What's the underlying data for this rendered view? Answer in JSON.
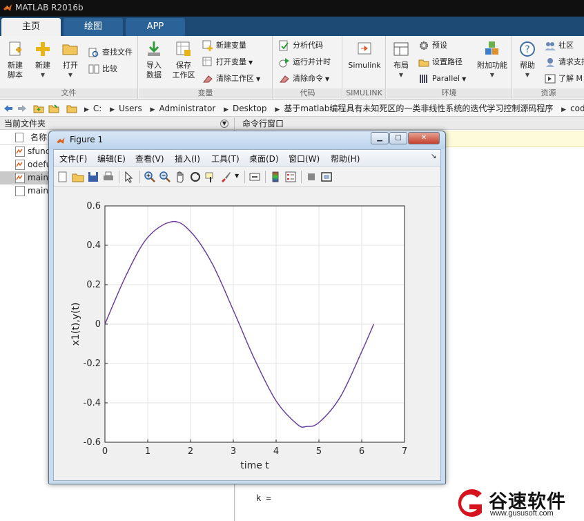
{
  "app": {
    "title": "MATLAB R2016b"
  },
  "tabs": [
    {
      "label": "主页",
      "active": true
    },
    {
      "label": "绘图",
      "active": false
    },
    {
      "label": "APP",
      "active": false
    }
  ],
  "ribbon": {
    "file": {
      "name": "文件",
      "new_script": "新建\n脚本",
      "new": "新建",
      "open": "打开",
      "find_files": "查找文件",
      "compare": "比较"
    },
    "variable": {
      "name": "变量",
      "import": "导入\n数据",
      "save_ws": "保存\n工作区",
      "new_var": "新建变量",
      "open_var": "打开变量",
      "clear_ws": "清除工作区"
    },
    "code": {
      "name": "代码",
      "analyze": "分析代码",
      "run_time": "运行并计时",
      "clear_cmd": "清除命令"
    },
    "simulink": {
      "name": "SIMULINK",
      "btn": "Simulink"
    },
    "env": {
      "name": "环境",
      "layout": "布局",
      "prefs": "预设",
      "set_path": "设置路径",
      "parallel": "Parallel",
      "addons": "附加功能"
    },
    "resources": {
      "name": "资源",
      "help": "帮助",
      "community": "社区",
      "request": "请求支持",
      "learn": "了解 M"
    }
  },
  "address": {
    "crumbs": [
      "C:",
      "Users",
      "Administrator",
      "Desktop",
      "基于matlab编程具有未知死区的一类非线性系统的迭代学习控制源码程序",
      "code"
    ]
  },
  "folder_panel": {
    "title": "当前文件夹",
    "col_name": "名称",
    "files": [
      {
        "name": "sfunc",
        "icon": "mfile-icon",
        "selected": false
      },
      {
        "name": "odefu",
        "icon": "mfile-icon",
        "selected": false
      },
      {
        "name": "main",
        "icon": "mfile-icon",
        "selected": true
      },
      {
        "name": "main",
        "icon": "file-icon",
        "selected": false
      }
    ]
  },
  "command_panel": {
    "title": "命令行窗口",
    "prompt": "k ="
  },
  "figure": {
    "title": "Figure 1",
    "menus": [
      "文件(F)",
      "编辑(E)",
      "查看(V)",
      "插入(I)",
      "工具(T)",
      "桌面(D)",
      "窗口(W)",
      "帮助(H)"
    ]
  },
  "chart_data": {
    "type": "line",
    "xlabel": "time t",
    "ylabel": "x1(t),y(t)",
    "xlim": [
      0,
      7
    ],
    "ylim": [
      -0.6,
      0.6
    ],
    "xticks": [
      "0",
      "1",
      "2",
      "3",
      "4",
      "5",
      "6",
      "7"
    ],
    "yticks": [
      "-0.6",
      "-0.4",
      "-0.2",
      "0",
      "0.2",
      "0.4",
      "0.6"
    ],
    "grid": true,
    "series": [
      {
        "color": "#3535cc",
        "x": [
          0,
          0.5,
          1.0,
          1.57,
          2.0,
          2.5,
          3.0,
          3.14,
          3.5,
          4.0,
          4.5,
          4.71,
          5.0,
          5.5,
          6.0,
          6.28
        ],
        "y": [
          0,
          0.25,
          0.44,
          0.52,
          0.47,
          0.31,
          0.07,
          0,
          -0.18,
          -0.39,
          -0.51,
          -0.52,
          -0.5,
          -0.37,
          -0.14,
          0
        ]
      },
      {
        "color": "#cc3535",
        "x": [
          0,
          0.5,
          1.0,
          1.57,
          2.0,
          2.5,
          3.0,
          3.14,
          3.5,
          4.0,
          4.5,
          4.71,
          5.0,
          5.5,
          6.0,
          6.28
        ],
        "y": [
          0,
          0.25,
          0.44,
          0.52,
          0.47,
          0.31,
          0.07,
          0,
          -0.18,
          -0.39,
          -0.51,
          -0.52,
          -0.5,
          -0.37,
          -0.14,
          0
        ]
      }
    ]
  },
  "watermark": {
    "text": "谷速软件",
    "url": "www.gususoft.com"
  },
  "colors": {
    "tabstrip": "#1d4a75",
    "tab": "#2b6399"
  }
}
